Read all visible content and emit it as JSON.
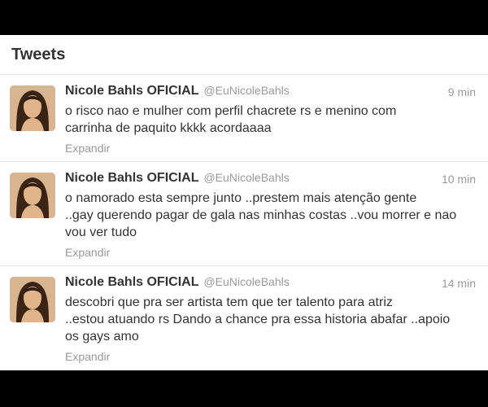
{
  "header": {
    "title": "Tweets"
  },
  "tweets": [
    {
      "name": "Nicole Bahls OFICIAL",
      "handle": "@EuNicoleBahls",
      "time": "9 min",
      "text": "o risco nao e mulher com perfil chacrete rs e menino com\ncarrinha de paquito kkkk acordaaaa",
      "expand": "Expandir",
      "avatar_icon": "profile-photo"
    },
    {
      "name": "Nicole Bahls OFICIAL",
      "handle": "@EuNicoleBahls",
      "time": "10 min",
      "text": "o namorado esta sempre junto ..prestem mais atenção gente\n..gay querendo pagar de gala nas minhas costas ..vou morrer e nao\nvou ver tudo",
      "expand": "Expandir",
      "avatar_icon": "profile-photo"
    },
    {
      "name": "Nicole Bahls OFICIAL",
      "handle": "@EuNicoleBahls",
      "time": "14 min",
      "text": "descobri que pra ser artista tem que ter talento  para atriz\n..estou atuando rs Dando a chance pra essa historia abafar ..apoio\nos gays amo",
      "expand": "Expandir",
      "avatar_icon": "profile-photo"
    }
  ],
  "colors": {
    "text": "#333333",
    "muted": "#999999",
    "border": "#e8e8e8",
    "outer_frame": "#000000"
  }
}
